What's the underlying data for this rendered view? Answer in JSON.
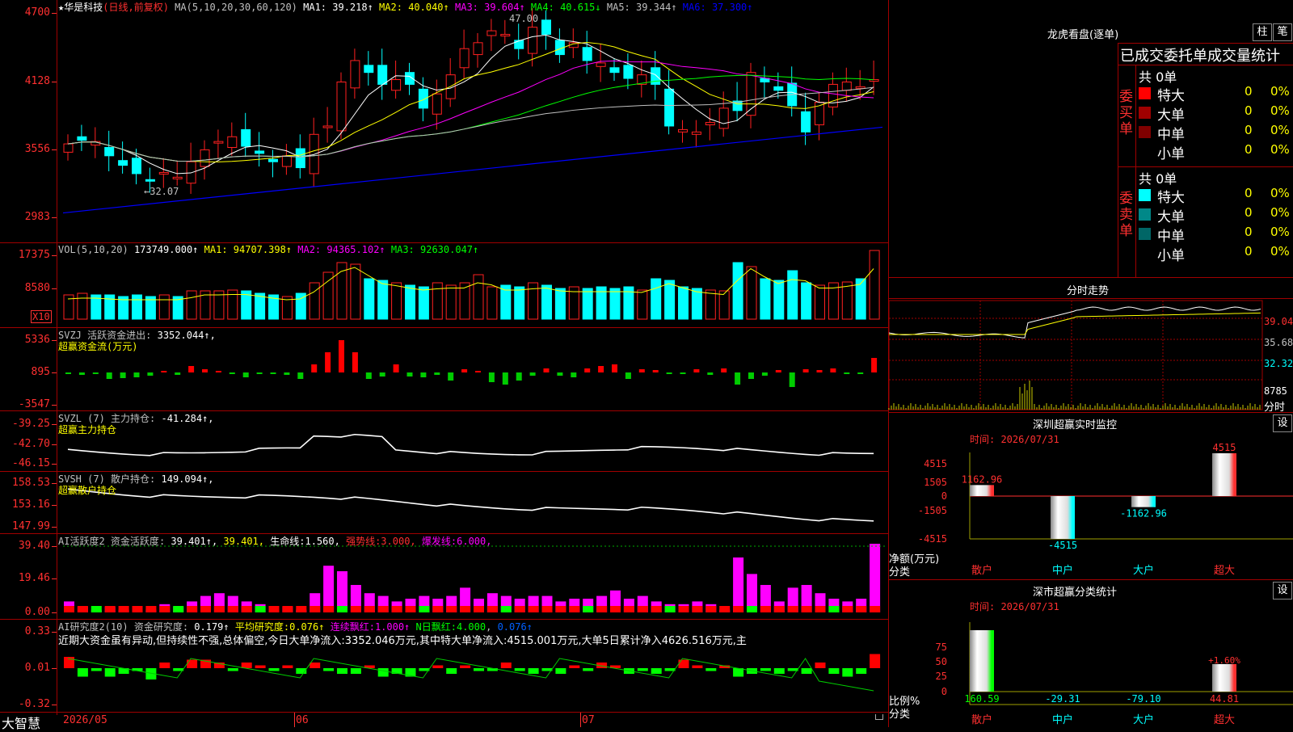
{
  "stock": {
    "star": "★",
    "name": "华是科技",
    "mode": "(日线,前复权)"
  },
  "colors": {
    "up": "#ff2020",
    "down": "#00ffff",
    "grid": "#a00000",
    "ma1": "#ffffff",
    "ma2": "#ffff00",
    "ma3": "#ff00ff",
    "ma4": "#00ff00",
    "ma5": "#c0c0c0",
    "ma6": "#0000ff"
  },
  "main": {
    "ma_label": "MA(5,10,20,30,60,120)",
    "ma": [
      {
        "k": "MA1",
        "v": "39.218↑",
        "c": "#ffffff"
      },
      {
        "k": "MA2",
        "v": "40.040↑",
        "c": "#ffff00"
      },
      {
        "k": "MA3",
        "v": "39.604↑",
        "c": "#ff00ff"
      },
      {
        "k": "MA4",
        "v": "40.615↓",
        "c": "#00ff00"
      },
      {
        "k": "MA5",
        "v": "39.344↑",
        "c": "#c0c0c0"
      },
      {
        "k": "MA6",
        "v": "37.300↑",
        "c": "#0000ff"
      }
    ],
    "yticks": [
      "4700",
      "4128",
      "3556",
      "2983"
    ],
    "high_label": "47.00",
    "low_label": "←32.07"
  },
  "vol": {
    "label": "VOL(5,10,20)",
    "value": "173749.000↑",
    "ma": [
      {
        "k": "MA1",
        "v": "94707.398↑",
        "c": "#ffff00"
      },
      {
        "k": "MA2",
        "v": "94365.102↑",
        "c": "#ff00ff"
      },
      {
        "k": "MA3",
        "v": "92630.047↑",
        "c": "#00ff00"
      }
    ],
    "yticks": [
      "17375",
      "8580"
    ],
    "unit": "X10"
  },
  "svzj": {
    "label": "SVZJ",
    "name": "活跃资金进出",
    "value": "3352.044↑,",
    "sub": "超赢资金流(万元)",
    "yticks": [
      "5336",
      "895",
      "-3547"
    ]
  },
  "svzl": {
    "label": "SVZL (7)",
    "name": "主力持仓",
    "value": "-41.284↑,",
    "sub": "超赢主力持仓",
    "yticks": [
      "-39.25",
      "-42.70",
      "-46.15"
    ]
  },
  "svsh": {
    "label": "SVSH (7)",
    "name": "散户持仓",
    "value": "149.094↑,",
    "sub": "超赢散户持仓",
    "yticks": [
      "158.53",
      "153.16",
      "147.99"
    ]
  },
  "ai1": {
    "label": "AI活跃度2",
    "name": "资金活跃度",
    "value": "39.401↑,",
    "v2": "39.401,",
    "life": "生命线:",
    "life_v": "1.560,",
    "strong": "强势线:",
    "strong_v": "3.000,",
    "burst": "爆发线:",
    "burst_v": "6.000,",
    "yticks": [
      "39.40",
      "19.46",
      "0.00"
    ]
  },
  "ai2": {
    "label": "AI研究度2(10)",
    "name": "资金研究度",
    "value": "0.179↑",
    "avg": "平均研究度:",
    "avg_v": "0.076↑",
    "cont": "连续飘红:",
    "cont_v": "1.000↑",
    "nday": "N日飘红:",
    "nday_v": "4.000",
    "last": "0.076↑",
    "comment": "近期大资金虽有异动,但持续性不强,总体偏空,今日大单净流入:3352.046万元,其中特大单净流入:4515.001万元,大单5日累计净入4626.516万元,主",
    "yticks": [
      "0.33",
      "0.01",
      "-0.32"
    ]
  },
  "xaxis": {
    "labels": [
      "2026/05",
      "06",
      "07"
    ],
    "brand": "大智慧"
  },
  "right": {
    "dragon": {
      "title": "龙虎看盘(逐单)",
      "btn1": "柱",
      "btn2": "笔",
      "header": "已成交委托单成交量统计",
      "buy": {
        "side": "委买单",
        "total": "共 0单",
        "rows": [
          {
            "n": "特大",
            "v": "0",
            "p": "0%",
            "c": "#ff0000"
          },
          {
            "n": "大单",
            "v": "0",
            "p": "0%",
            "c": "#a00000"
          },
          {
            "n": "中单",
            "v": "0",
            "p": "0%",
            "c": "#800000"
          },
          {
            "n": "小单",
            "v": "0",
            "p": "0%",
            "c": ""
          }
        ]
      },
      "sell": {
        "side": "委卖单",
        "total": "共 0单",
        "rows": [
          {
            "n": "特大",
            "v": "0",
            "p": "0%",
            "c": "#00ffff"
          },
          {
            "n": "大单",
            "v": "0",
            "p": "0%",
            "c": "#008888"
          },
          {
            "n": "中单",
            "v": "0",
            "p": "0%",
            "c": "#006666"
          },
          {
            "n": "小单",
            "v": "0",
            "p": "0%",
            "c": ""
          }
        ]
      }
    },
    "intraday": {
      "title": "分时走势",
      "yticks": [
        "39.04",
        "35.68",
        "32.32"
      ],
      "vol": "8785",
      "vol_unit": "分时"
    },
    "monitor": {
      "title": "深圳超赢实时监控",
      "btn": "设",
      "time": "时间: 2026/07/31",
      "yticks": [
        "4515",
        "1505",
        "0",
        "-1505",
        "-4515"
      ],
      "ylabel": "净额(万元)",
      "xcat": "分类",
      "bars": [
        {
          "cat": "散户",
          "label": "1162.96",
          "value": 1162.96
        },
        {
          "cat": "中户",
          "label": "-4515",
          "value": -4515
        },
        {
          "cat": "大户",
          "label": "-1162.96",
          "value": -1162.96
        },
        {
          "cat": "超大",
          "label": "4515",
          "value": 4515
        }
      ]
    },
    "classify": {
      "title": "深市超赢分类统计",
      "btn": "设",
      "time": "时间: 2026/07/31",
      "yticks": [
        "75",
        "50",
        "25",
        "0"
      ],
      "ylabel": "比例%",
      "xcat": "分类",
      "pct": "+1.60%",
      "bars": [
        {
          "cat": "散户",
          "label": "160.59",
          "value": 100
        },
        {
          "cat": "中户",
          "label": "-29.31",
          "value": 0
        },
        {
          "cat": "大户",
          "label": "-79.10",
          "value": 0
        },
        {
          "cat": "超大",
          "label": "44.81",
          "value": 44.81
        }
      ]
    }
  }
}
